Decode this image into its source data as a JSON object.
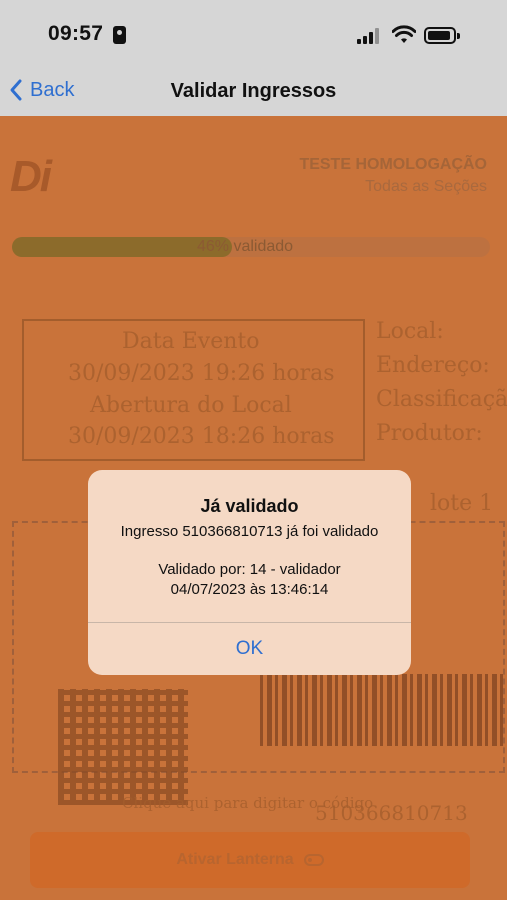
{
  "status_bar": {
    "time": "09:57"
  },
  "nav": {
    "back_label": "Back",
    "title": "Validar Ingressos"
  },
  "header": {
    "logo": "Di",
    "event_name": "TESTE HOMOLOGAÇÃO",
    "section": "Todas as Seções"
  },
  "progress": {
    "percent": 46,
    "label": "46% validado"
  },
  "ticket_background": {
    "lines": [
      "Data Evento",
      "30/09/2023 19:26 horas",
      "Abertura do Local",
      "30/09/2023 18:26 horas"
    ],
    "side_lines": [
      "Local:",
      "Endereço:",
      "Classificação",
      "Produtor:"
    ],
    "hint": "Clique aqui para digitar o código",
    "code": "510366810713",
    "lote": "lote 1"
  },
  "flashlight": {
    "label": "Ativar Lanterna"
  },
  "alert": {
    "title": "Já validado",
    "message": "Ingresso 510366810713 já foi validado",
    "validated_by": "Validado por: 14 - validador",
    "validated_at": "04/07/2023 às 13:46:14",
    "ok_label": "OK"
  },
  "colors": {
    "accent_blue": "#2f6fd0",
    "overlay_orange": "#c9733a",
    "alert_bg": "#f5d9c5"
  }
}
